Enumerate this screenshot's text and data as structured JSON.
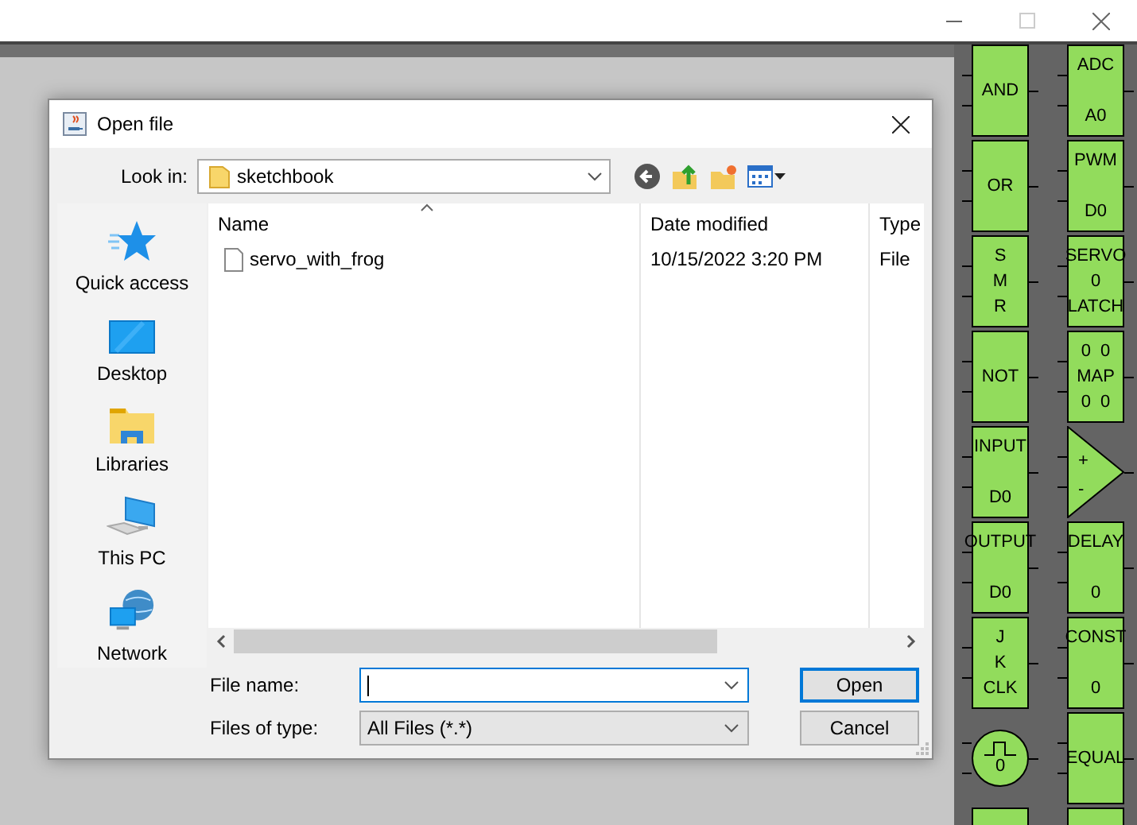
{
  "dialog": {
    "title": "Open file",
    "look_in": {
      "label": "Look in:",
      "value": "sketchbook"
    },
    "places": [
      {
        "label": "Quick access",
        "kind": "star"
      },
      {
        "label": "Desktop",
        "kind": "desktop"
      },
      {
        "label": "Libraries",
        "kind": "libraries"
      },
      {
        "label": "This PC",
        "kind": "pc"
      },
      {
        "label": "Network",
        "kind": "network"
      }
    ],
    "columns": [
      "Name",
      "Date modified",
      "Type"
    ],
    "files": [
      {
        "name": "servo_with_frog",
        "date_modified": "10/15/2022 3:20 PM",
        "type": "File",
        "selected": false
      }
    ],
    "file_name": {
      "label": "File name:"
    },
    "file_type": {
      "label": "Files of type:",
      "value": "All Files (*.*)"
    },
    "buttons": [
      {
        "label": "Open",
        "default": true
      },
      {
        "label": "Cancel",
        "default": false
      }
    ]
  },
  "palette": {
    "columns": [
      [
        {
          "kind": "box",
          "lines": [
            "AND"
          ]
        },
        {
          "kind": "box",
          "lines": [
            "OR"
          ]
        },
        {
          "kind": "box",
          "lines": [
            "S",
            "M",
            "R"
          ]
        },
        {
          "kind": "box",
          "lines": [
            "NOT"
          ]
        },
        {
          "kind": "box",
          "lines": [
            "INPUT",
            "D0"
          ]
        },
        {
          "kind": "box",
          "lines": [
            "OUTPUT",
            "D0"
          ]
        },
        {
          "kind": "box",
          "lines": [
            "J",
            "K",
            "CLK"
          ]
        },
        {
          "kind": "circle",
          "lines": [
            "0"
          ]
        },
        {
          "kind": "box"
        }
      ],
      [
        {
          "kind": "box",
          "lines": [
            "ADC",
            "A0"
          ]
        },
        {
          "kind": "box",
          "lines": [
            "PWM",
            "D0"
          ]
        },
        {
          "kind": "box",
          "lines": [
            "SERVO",
            "0",
            "LATCH"
          ]
        },
        {
          "kind": "box",
          "lines": [
            "0  0",
            "MAP",
            "0  0"
          ]
        },
        {
          "kind": "triangle",
          "lines": [
            "+",
            "-"
          ]
        },
        {
          "kind": "box",
          "lines": [
            "DELAY",
            "0"
          ]
        },
        {
          "kind": "box",
          "lines": [
            "CONST",
            "0"
          ]
        },
        {
          "kind": "box",
          "lines": [
            "EQUAL"
          ]
        },
        {
          "kind": "box"
        }
      ]
    ]
  }
}
